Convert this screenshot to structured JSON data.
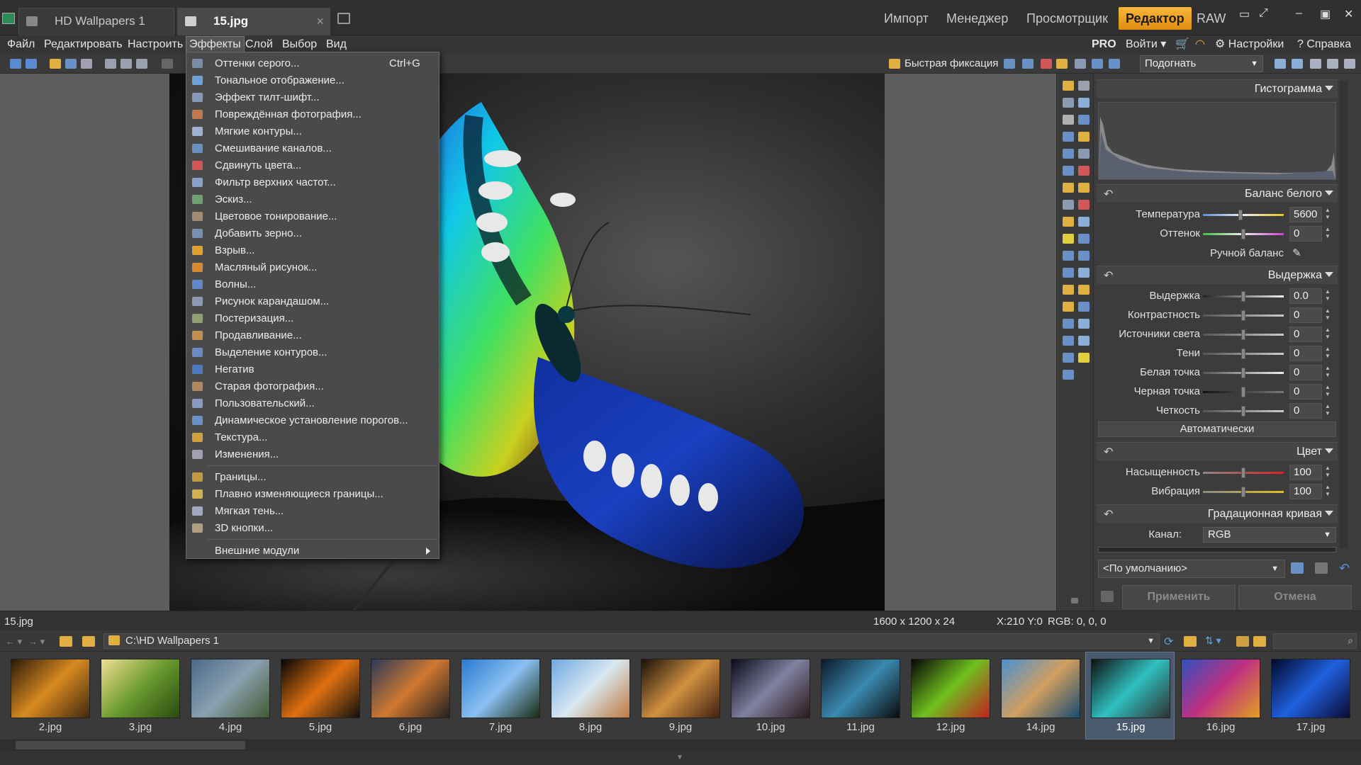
{
  "tabs": [
    {
      "label": "HD Wallpapers 1",
      "active": false
    },
    {
      "label": "15.jpg",
      "active": true
    }
  ],
  "modes": [
    "Импорт",
    "Менеджер",
    "Просмотрщик",
    "Редактор",
    "RAW"
  ],
  "active_mode": "Редактор",
  "menu": [
    "Файл",
    "Редактировать",
    "Настроить",
    "Эффекты",
    "Слой",
    "Выбор",
    "Вид"
  ],
  "open_menu": "Эффекты",
  "right_menu": {
    "pro": "PRO",
    "login": "Войти",
    "settings": "Настройки",
    "help": "Справка"
  },
  "toolbar": {
    "quick_fix": "Быстрая фиксация",
    "zoom": "Подогнать"
  },
  "effects_menu": {
    "group1": [
      {
        "label": "Оттенки серого...",
        "shortcut": "Ctrl+G",
        "icon": "#7a8ca8"
      },
      {
        "label": "Тональное отображение...",
        "icon": "#6fa0d8"
      },
      {
        "label": "Эффект тилт-шифт...",
        "icon": "#8898b8"
      },
      {
        "label": "Повреждённая фотография...",
        "icon": "#c07850"
      },
      {
        "label": "Мягкие контуры...",
        "icon": "#a0b0d0"
      },
      {
        "label": "Смешивание каналов...",
        "icon": "#6a90c0"
      },
      {
        "label": "Сдвинуть цвета...",
        "icon": "#d05858"
      },
      {
        "label": "Фильтр верхних частот...",
        "icon": "#8aa0c8"
      },
      {
        "label": "Эскиз...",
        "icon": "#70a070"
      },
      {
        "label": "Цветовое тонирование...",
        "icon": "#a08c70"
      },
      {
        "label": "Добавить зерно...",
        "icon": "#7890b0"
      },
      {
        "label": "Взрыв...",
        "icon": "#e0a030"
      },
      {
        "label": "Масляный рисунок...",
        "icon": "#d88a30"
      },
      {
        "label": "Волны...",
        "icon": "#6088c8"
      },
      {
        "label": "Рисунок карандашом...",
        "icon": "#8a9ab0"
      },
      {
        "label": "Постеризация...",
        "icon": "#90a070"
      },
      {
        "label": "Продавливание...",
        "icon": "#c09050"
      },
      {
        "label": "Выделение контуров...",
        "icon": "#6a8ac0"
      },
      {
        "label": "Негатив",
        "icon": "#5078c0"
      },
      {
        "label": "Старая фотография...",
        "icon": "#b08860"
      },
      {
        "label": "Пользовательский...",
        "icon": "#8a9ac0"
      },
      {
        "label": "Динамическое установление порогов...",
        "icon": "#6a90c8"
      },
      {
        "label": "Текстура...",
        "icon": "#d0a040"
      },
      {
        "label": "Изменения...",
        "icon": "#a0a0b0"
      }
    ],
    "group2": [
      {
        "label": "Границы...",
        "icon": "#c09a40"
      },
      {
        "label": "Плавно изменяющиеся границы...",
        "icon": "#d0b050"
      },
      {
        "label": "Мягкая тень...",
        "icon": "#a0a8c0"
      },
      {
        "label": "3D кнопки...",
        "icon": "#b0a080"
      }
    ],
    "plugins": {
      "label": "Внешние модули"
    }
  },
  "panel": {
    "histogram_title": "Гистограмма",
    "white_balance": {
      "title": "Баланс белого",
      "temperature_label": "Температура",
      "temperature": "5600",
      "tint_label": "Оттенок",
      "tint": "0",
      "manual": "Ручной баланс"
    },
    "exposure": {
      "title": "Выдержка",
      "rows": [
        {
          "label": "Выдержка",
          "value": "0.0"
        },
        {
          "label": "Контрастность",
          "value": "0"
        },
        {
          "label": "Источники света",
          "value": "0"
        },
        {
          "label": "Тени",
          "value": "0"
        },
        {
          "label": "Белая точка",
          "value": "0"
        },
        {
          "label": "Черная точка",
          "value": "0"
        },
        {
          "label": "Четкость",
          "value": "0"
        }
      ],
      "auto": "Автоматически"
    },
    "color": {
      "title": "Цвет",
      "saturation_label": "Насыщенность",
      "saturation": "100",
      "vibrance_label": "Вибрация",
      "vibrance": "100"
    },
    "curve": {
      "title": "Градационная кривая",
      "channel_label": "Канал:",
      "channel": "RGB"
    },
    "preset": "<По умолчанию>",
    "apply": "Применить",
    "cancel": "Отмена"
  },
  "status": {
    "filename": "15.jpg",
    "dims": "1600 x 1200 x 24",
    "coords": "X:210 Y:0",
    "rgb": "RGB: 0, 0, 0"
  },
  "browser": {
    "path": "C:\\HD Wallpapers 1"
  },
  "thumbnails": [
    {
      "label": "2.jpg",
      "colors": [
        "#2a1a08",
        "#d88a20",
        "#402810"
      ]
    },
    {
      "label": "3.jpg",
      "colors": [
        "#f0e090",
        "#6a9a30",
        "#2a4a10"
      ]
    },
    {
      "label": "4.jpg",
      "colors": [
        "#4a6a8a",
        "#8aa0b0",
        "#405a30"
      ]
    },
    {
      "label": "5.jpg",
      "colors": [
        "#050505",
        "#e07010",
        "#101010"
      ]
    },
    {
      "label": "6.jpg",
      "colors": [
        "#2a3a5a",
        "#d07830",
        "#202020"
      ]
    },
    {
      "label": "7.jpg",
      "colors": [
        "#2a7ad0",
        "#8ac0f0",
        "#1a2a10"
      ]
    },
    {
      "label": "8.jpg",
      "colors": [
        "#70a8e0",
        "#d8e8f0",
        "#c07840"
      ]
    },
    {
      "label": "9.jpg",
      "colors": [
        "#1a1008",
        "#d09040",
        "#402010"
      ]
    },
    {
      "label": "10.jpg",
      "colors": [
        "#0a0a18",
        "#8080a0",
        "#2a1a1a"
      ]
    },
    {
      "label": "11.jpg",
      "colors": [
        "#0a1a2a",
        "#3a8ab0",
        "#0a0a0a"
      ]
    },
    {
      "label": "12.jpg",
      "colors": [
        "#050505",
        "#70c020",
        "#c02020"
      ]
    },
    {
      "label": "14.jpg",
      "colors": [
        "#4a90d0",
        "#d0a060",
        "#1a4a70"
      ]
    },
    {
      "label": "15.jpg",
      "colors": [
        "#101010",
        "#30c0c0",
        "#303030"
      ]
    },
    {
      "label": "16.jpg",
      "colors": [
        "#3050c0",
        "#c03080",
        "#e0a020"
      ]
    },
    {
      "label": "17.jpg",
      "colors": [
        "#000a2a",
        "#2060e0",
        "#0a0a30"
      ]
    }
  ],
  "selected_thumbnail": "15.jpg"
}
